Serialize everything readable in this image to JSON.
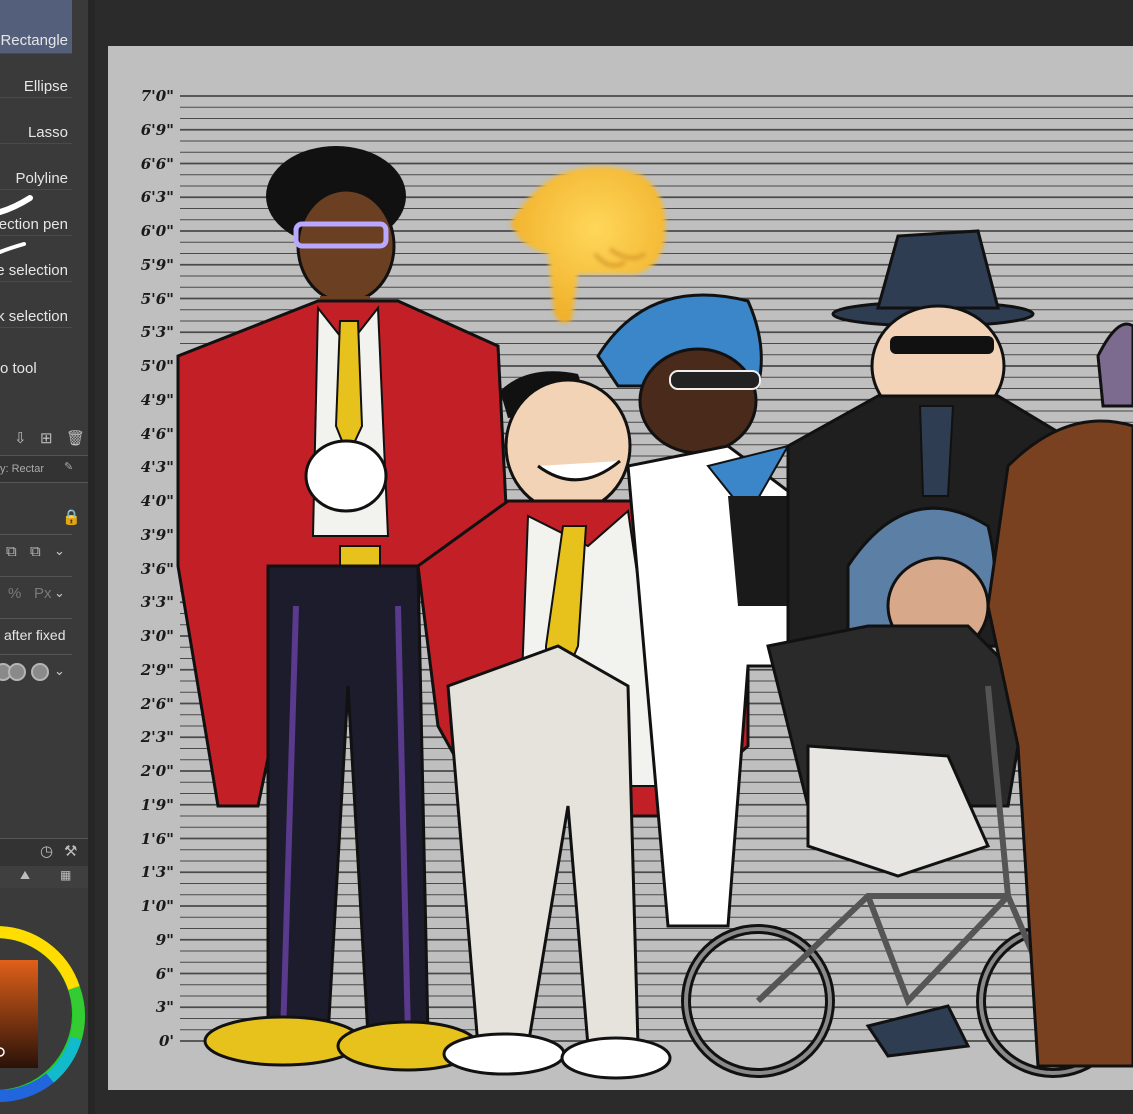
{
  "tool_panel": {
    "items": [
      {
        "label": "Rectangle",
        "active": true
      },
      {
        "label": "Ellipse",
        "active": false
      },
      {
        "label": "Lasso",
        "active": false
      },
      {
        "label": "Polyline",
        "active": false
      },
      {
        "label": "ection pen",
        "active": false
      },
      {
        "label": "e selection",
        "active": false
      },
      {
        "label": "k selection",
        "active": false
      },
      {
        "label": "o tool",
        "active": false
      }
    ],
    "property_header": "y: Rectar",
    "after_fixed_label": "after fixed",
    "active_color": "#54607b"
  },
  "height_chart": {
    "labels": [
      "7'0\"",
      "6'9\"",
      "6'6\"",
      "6'3\"",
      "6'0\"",
      "5'9\"",
      "5'6\"",
      "5'3\"",
      "5'0\"",
      "4'9\"",
      "4'6\"",
      "4'3\"",
      "4'0\"",
      "3'9\"",
      "3'6\"",
      "3'3\"",
      "3'0\"",
      "2'9\"",
      "2'6\"",
      "2'3\"",
      "2'0\"",
      "1'9\"",
      "1'6\"",
      "1'3\"",
      "1'0\"",
      "9\"",
      "6\"",
      "3\"",
      "0'"
    ],
    "background": "#bfbfbf"
  },
  "characters": [
    {
      "name": "tall-red-suit-man",
      "suit_color": "#c21f26",
      "tie_color": "#e8c21c"
    },
    {
      "name": "leaning-red-suit-man",
      "suit_color": "#c21f26",
      "tie_color": "#e8c21c"
    },
    {
      "name": "turban-woman",
      "turban_color": "#3a86c8"
    },
    {
      "name": "fedora-man",
      "hat_color": "#2e3d52"
    },
    {
      "name": "hooded-kid-on-bike",
      "hood_color": "#5c7fa6"
    },
    {
      "name": "furry-creature",
      "fur_color": "#7a4120"
    }
  ],
  "overlay_icon": "pointing-down-hand-icon"
}
